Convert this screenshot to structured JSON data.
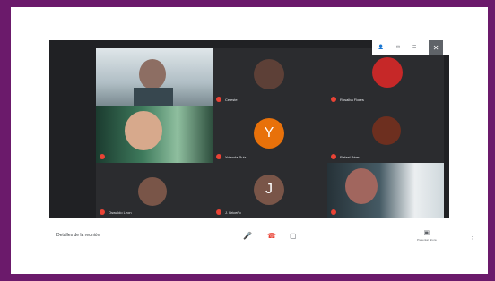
{
  "topbar": {
    "close_icon": "close-icon"
  },
  "tiles": [
    {
      "name": ""
    },
    {
      "name": ""
    },
    {
      "name": "Celeste"
    },
    {
      "name": "Rosalba Flores"
    },
    {
      "name": "Yolanda Ruiz"
    },
    {
      "avatar": "Y"
    },
    {
      "name": "Oswaldo Leon"
    },
    {
      "name": "Rafael Pérez"
    },
    {
      "name": "J. Briceño"
    },
    {
      "avatar": "J"
    },
    {
      "name": ""
    }
  ],
  "bottombar": {
    "meeting_details": "Detalles de la reunión",
    "present_label": "Presentar ahora"
  },
  "colors": {
    "accent_orange": "#e8710a",
    "hangup_red": "#ea4335",
    "stage": "#202124"
  }
}
